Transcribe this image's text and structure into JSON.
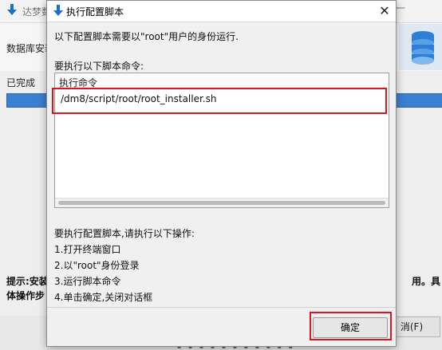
{
  "background_window": {
    "title": "达梦数",
    "step_label": "数据库安装",
    "done_label": "已完成",
    "progress": 1.0,
    "hint_text": "提示:安装",
    "hint_text2": "体操作步",
    "hint_right": "用。具",
    "cancel_label": "消(F)"
  },
  "dialog": {
    "title": "执行配置脚本",
    "description": "以下配置脚本需要以\"root\"用户的身份运行.",
    "command_list_label": "要执行以下脚本命令:",
    "table": {
      "column_header": "执行命令",
      "rows": [
        "/dm8/script/root/root_installer.sh"
      ]
    },
    "steps": [
      "要执行配置脚本,请执行以下操作:",
      "1.打开终端窗口",
      "2.以\"root\"身份登录",
      "3.运行脚本命令",
      "4.单击确定,关闭对话框"
    ],
    "ok_label": "确定",
    "close_glyph": "✕"
  },
  "colors": {
    "highlight": "#e0141e",
    "progress": "#3b7fd0",
    "arrow_icon": "#1a6fd1"
  },
  "icons": [
    "download-arrow-icon",
    "close-icon",
    "database-logo-icon"
  ]
}
